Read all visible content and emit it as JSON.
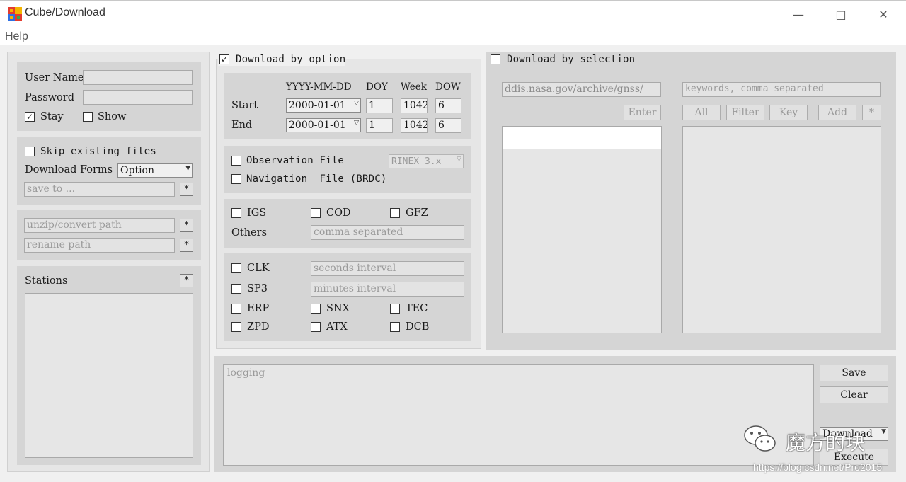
{
  "window": {
    "title": "Cube/Download"
  },
  "menu": {
    "help": "Help"
  },
  "login": {
    "user_name_label": "User Name",
    "password_label": "Password",
    "stay_label": "Stay",
    "stay_checked": true,
    "show_label": "Show",
    "show_checked": false
  },
  "files": {
    "skip_label": "Skip existing files",
    "download_forms_label": "Download Forms",
    "download_forms_value": "Option",
    "save_to_placeholder": "save to ...",
    "star": "*"
  },
  "paths": {
    "unzip_placeholder": "unzip/convert path",
    "rename_placeholder": "rename path"
  },
  "stations": {
    "label": "Stations"
  },
  "option": {
    "title": "Download by option",
    "checked": true,
    "date_header": "YYYY-MM-DD",
    "doy_header": "DOY",
    "week_header": "Week",
    "dow_header": "DOW",
    "start_label": "Start",
    "end_label": "End",
    "start": {
      "date": "2000-01-01",
      "doy": "1",
      "week": "1042",
      "dow": "6"
    },
    "end": {
      "date": "2000-01-01",
      "doy": "1",
      "week": "1042",
      "dow": "6"
    },
    "observation_label": "Observation File",
    "rinex_value": "RINEX 3.x",
    "navigation_label": "Navigation  File (BRDC)",
    "igs_label": "IGS",
    "cod_label": "COD",
    "gfz_label": "GFZ",
    "others_label": "Others",
    "others_placeholder": "comma separated",
    "clk_label": "CLK",
    "clk_placeholder": "seconds interval",
    "sp3_label": "SP3",
    "sp3_placeholder": "minutes interval",
    "erp_label": "ERP",
    "snx_label": "SNX",
    "tec_label": "TEC",
    "zpd_label": "ZPD",
    "atx_label": "ATX",
    "dcb_label": "DCB"
  },
  "selection": {
    "title": "Download by selection",
    "checked": false,
    "url_placeholder": "ddis.nasa.gov/archive/gnss/",
    "enter_label": "Enter",
    "keywords_placeholder": "keywords, comma separated",
    "all_label": "All",
    "filter_label": "Filter",
    "key_label": "Key",
    "add_label": "Add",
    "star": "*"
  },
  "log": {
    "placeholder": "logging",
    "save_label": "Save",
    "clear_label": "Clear",
    "mode_value": "Download",
    "execute_label": "Execute"
  },
  "watermark": {
    "text": "魔方的块",
    "url": "https://blog.csdn.net/Pro2015"
  }
}
